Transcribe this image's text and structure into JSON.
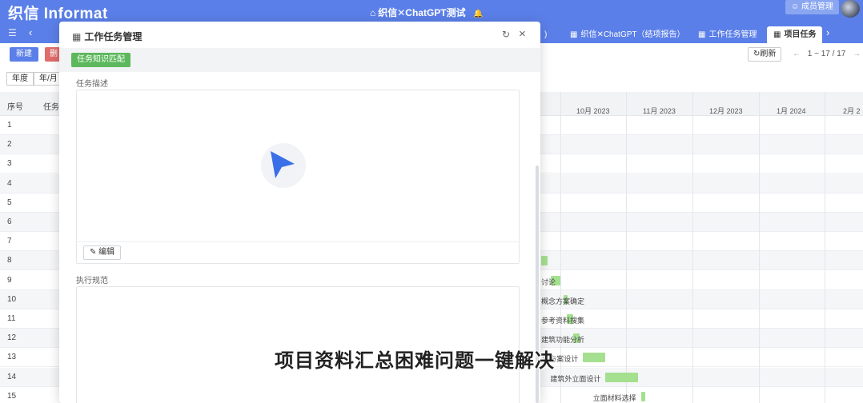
{
  "header": {
    "logo": "织信 Informat",
    "app_title": "织信✕ChatGPT测试",
    "member_button": "成员管理"
  },
  "tabs": [
    {
      "label": "织信✕ChatGPT（结项报告）"
    },
    {
      "label": "工作任务管理"
    },
    {
      "label": "项目任务",
      "active": true
    }
  ],
  "toolbar": {
    "new_label": "新建",
    "delete_label": "删",
    "refresh_label": "刷新",
    "pager": "1 ~ 17 / 17",
    "view_day": "年度",
    "view_month": "年/月"
  },
  "table": {
    "col_seq": "序号",
    "col_task": "任务",
    "rows": [
      "1",
      "2",
      "3",
      "4",
      "5",
      "6",
      "7",
      "8",
      "9",
      "10",
      "11",
      "12",
      "13",
      "14",
      "15"
    ],
    "months": [
      "10月 2023",
      "11月 2023",
      "12月 2023",
      "1月 2024",
      "2月 2"
    ]
  },
  "gantt": [
    {
      "row": 8,
      "label": "",
      "start": 0.0,
      "end": 0.02
    },
    {
      "row": 9,
      "label": "讨论",
      "start": 0.03,
      "end": 0.06
    },
    {
      "row": 10,
      "label": "概念方案确定",
      "start": 0.07,
      "end": 0.075
    },
    {
      "row": 11,
      "label": "参考资料搜集",
      "start": 0.08,
      "end": 0.1
    },
    {
      "row": 12,
      "label": "建筑功能分析",
      "start": 0.1,
      "end": 0.12
    },
    {
      "row": 13,
      "label": "置方案设计",
      "start": 0.13,
      "end": 0.2
    },
    {
      "row": 14,
      "label": "建筑外立面设计",
      "start": 0.2,
      "end": 0.3
    },
    {
      "row": 15,
      "label": "立面材料选择",
      "start": 0.31,
      "end": 0.32
    }
  ],
  "modal": {
    "title": "工作任务管理",
    "match_button": "任务知识匹配",
    "field1_label": "任务描述",
    "field2_label": "执行规范",
    "edit_label": "编辑"
  },
  "caption": "项目资料汇总困难问题一键解决",
  "colors": {
    "primary": "#5b7fe8",
    "success": "#5cb85c",
    "danger": "#e06c6c",
    "gantt_bar": "#a4e08f"
  }
}
